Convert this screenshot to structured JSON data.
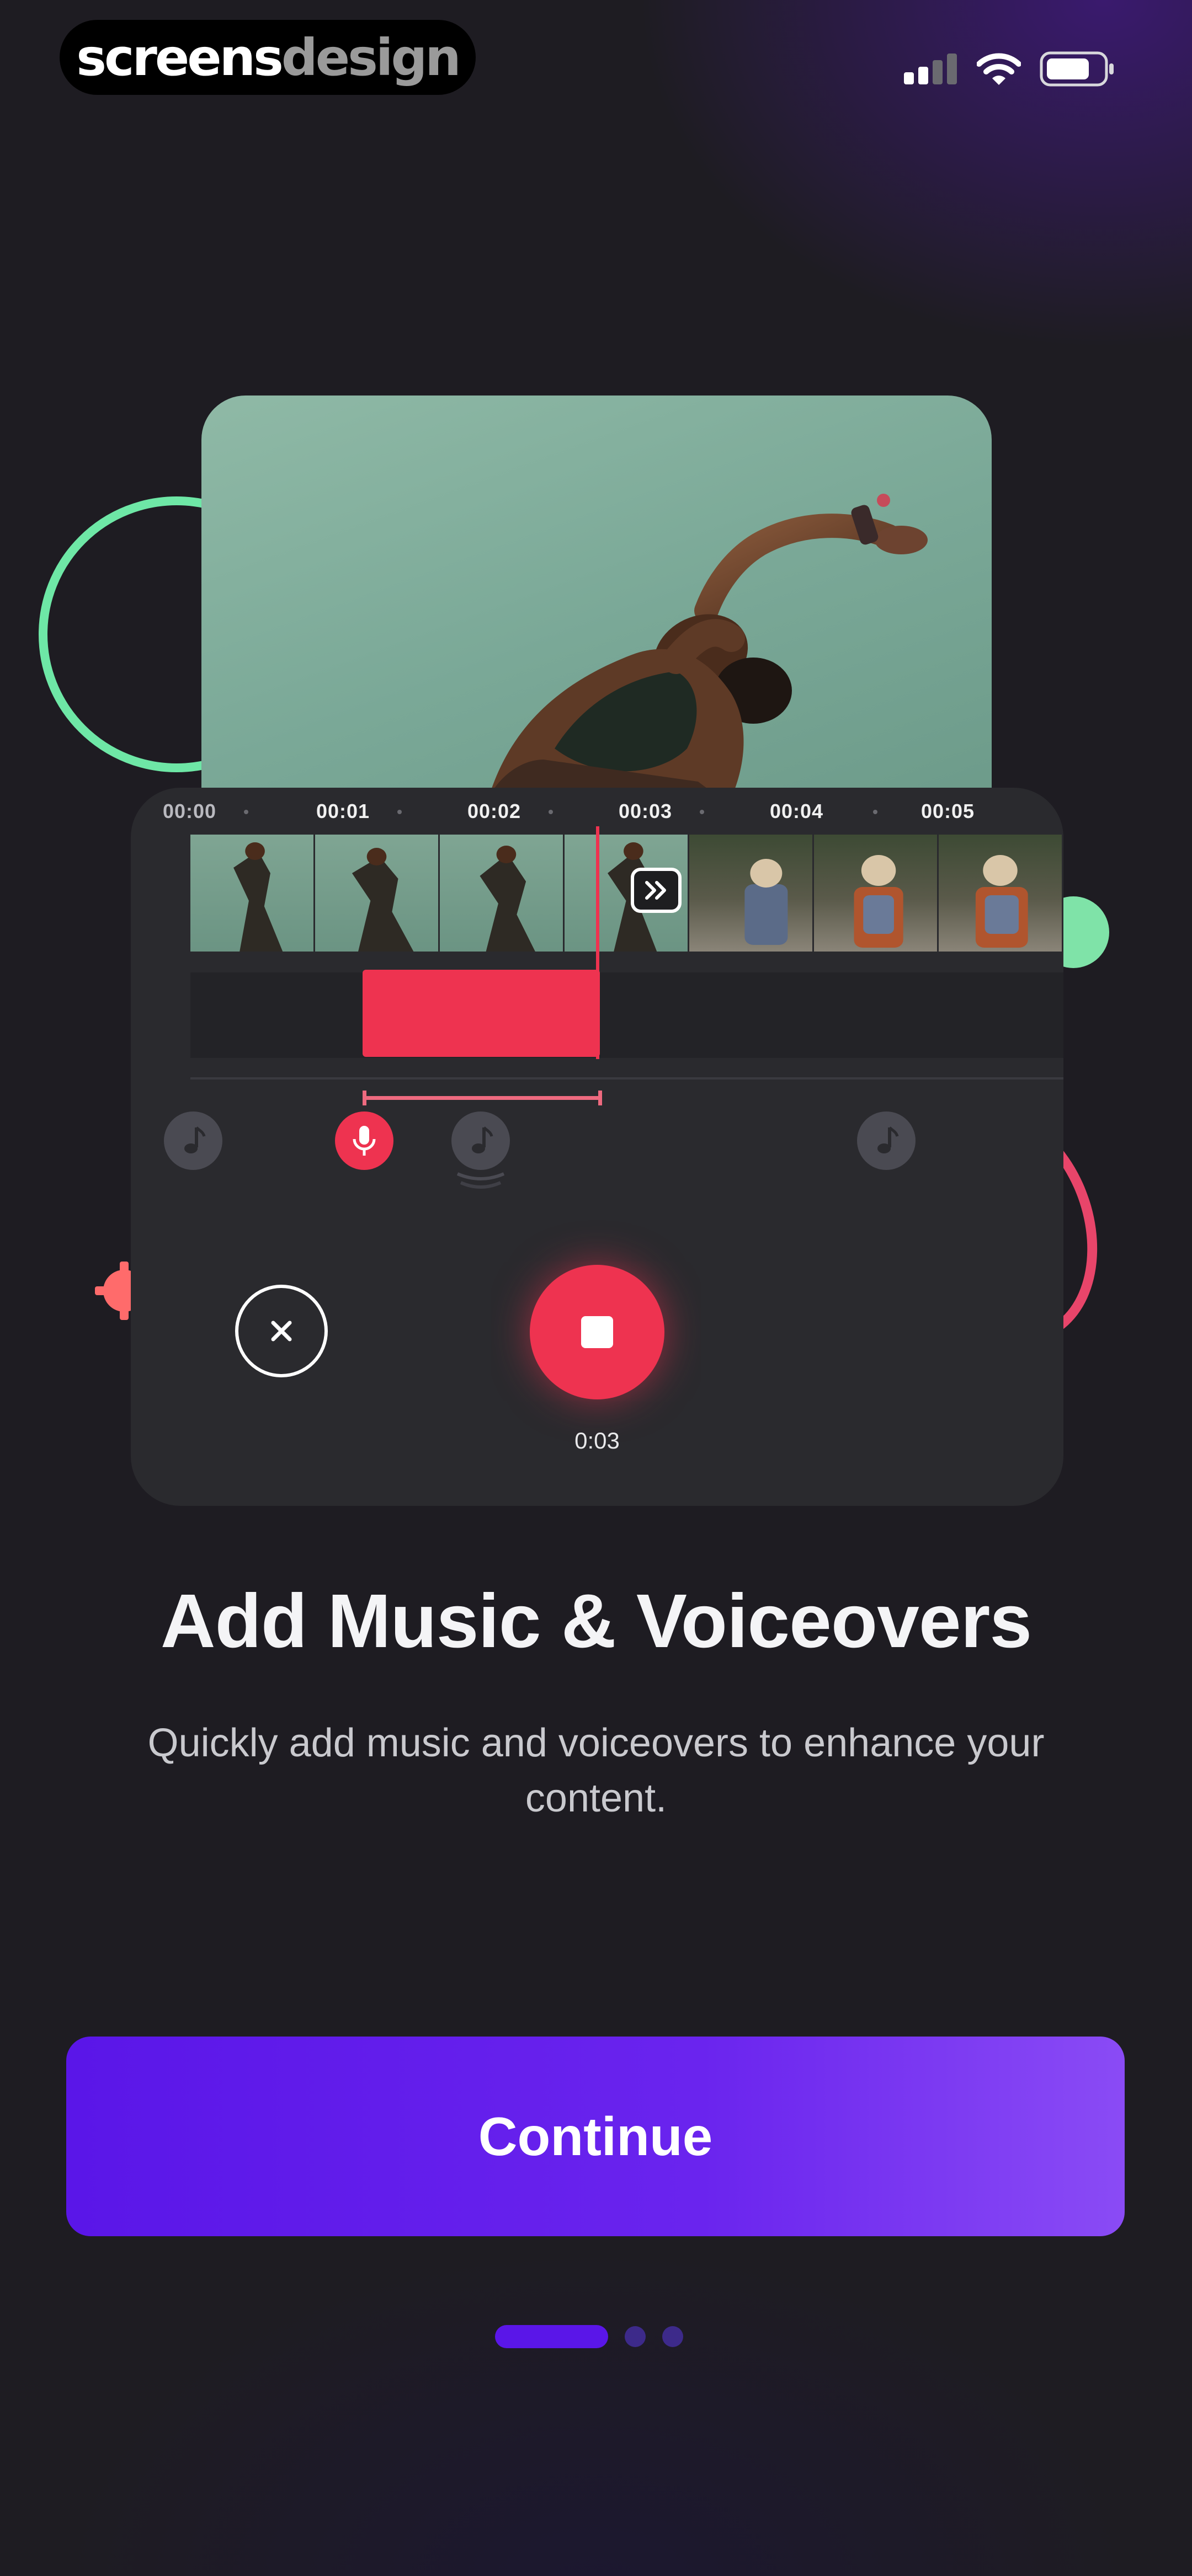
{
  "brand": {
    "part1": "screens",
    "part2": "design"
  },
  "status_bar": {
    "icons": [
      "signal-icon",
      "wifi-icon",
      "battery-icon"
    ]
  },
  "editor": {
    "timeline_ticks": [
      "00:00",
      "00:01",
      "00:02",
      "00:03",
      "00:04",
      "00:05"
    ],
    "record_time": "0:03",
    "track_icons": [
      "music-note-icon",
      "microphone-icon",
      "music-note-icon",
      "music-note-icon"
    ]
  },
  "onboarding": {
    "title": "Add Music & Voiceovers",
    "subtitle": "Quickly add music and voiceovers to enhance your content.",
    "continue_label": "Continue",
    "page_index": 1,
    "page_count": 3
  },
  "colors": {
    "accent": "#5a16e8",
    "record": "#ee3350",
    "deco_green": "#6ee7a6"
  }
}
